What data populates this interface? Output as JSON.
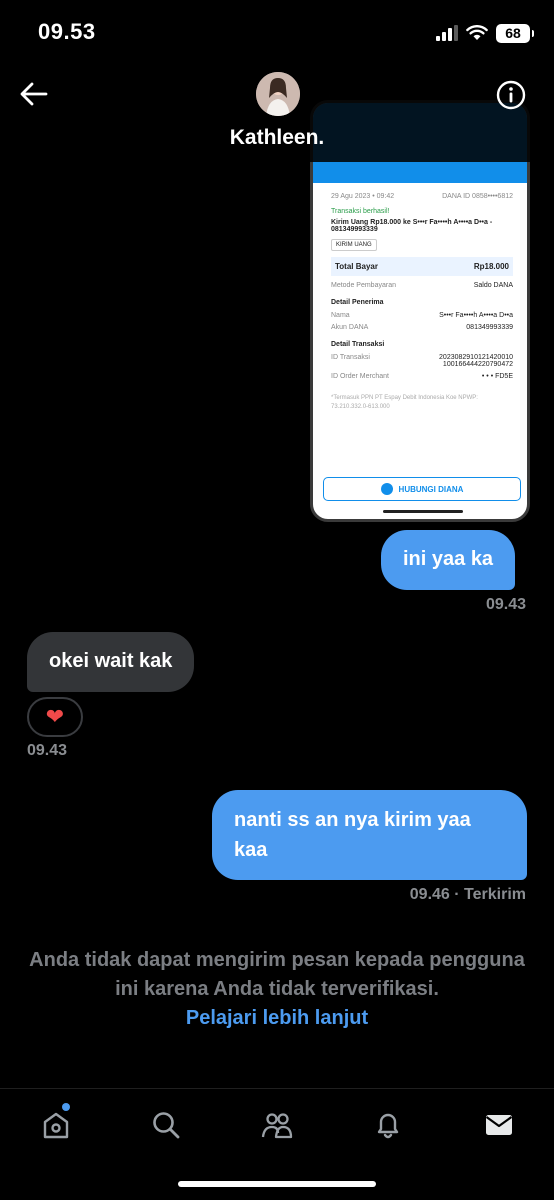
{
  "status": {
    "time": "09.53",
    "battery": "68"
  },
  "header": {
    "name": "Kathleen."
  },
  "receipt": {
    "date": "29 Agu 2023 • 09:42",
    "dana_id": "DANA ID 0858••••6812",
    "status": "Transaksi berhasil!",
    "desc": "Kirim Uang Rp18.000 ke S•••r Fa••••h A••••a D••a - 081349993339",
    "tag": "KIRIM UANG",
    "total_label": "Total Bayar",
    "total_value": "Rp18.000",
    "method_label": "Metode Pembayaran",
    "method_value": "Saldo DANA",
    "recipient_title": "Detail Penerima",
    "name_label": "Nama",
    "name_value": "S•••r Fa••••h A••••a D••a",
    "account_label": "Akun DANA",
    "account_value": "081349993339",
    "tx_title": "Detail Transaksi",
    "txid_label": "ID Transaksi",
    "txid_value": "2023082910121420010 100166444220790472",
    "merchant_label": "ID Order Merchant",
    "merchant_value": "• • • FD5E",
    "footer": "*Termasuk PPN PT Espay Debit Indonesia Koe NPWP: 73.210.332.0-613.000",
    "button": "HUBUNGI DIANA"
  },
  "messages": [
    {
      "text": "ini yaa ka",
      "time": "09.43"
    },
    {
      "text": "okei wait kak",
      "time": "09.43",
      "reaction": "❤"
    },
    {
      "text": "nanti ss an nya kirim yaa kaa",
      "time": "09.46 · Terkirim"
    }
  ],
  "notice": {
    "text": "Anda tidak dapat mengirim pesan kepada pengguna ini karena Anda tidak terverifikasi.",
    "link": "Pelajari lebih lanjut"
  },
  "tabs": [
    "home-icon",
    "search-icon",
    "communities-icon",
    "notifications-icon",
    "messages-icon"
  ],
  "colors": {
    "accent": "#4c9bf0",
    "received_bubble": "#333538",
    "dana_blue": "#118eea"
  }
}
